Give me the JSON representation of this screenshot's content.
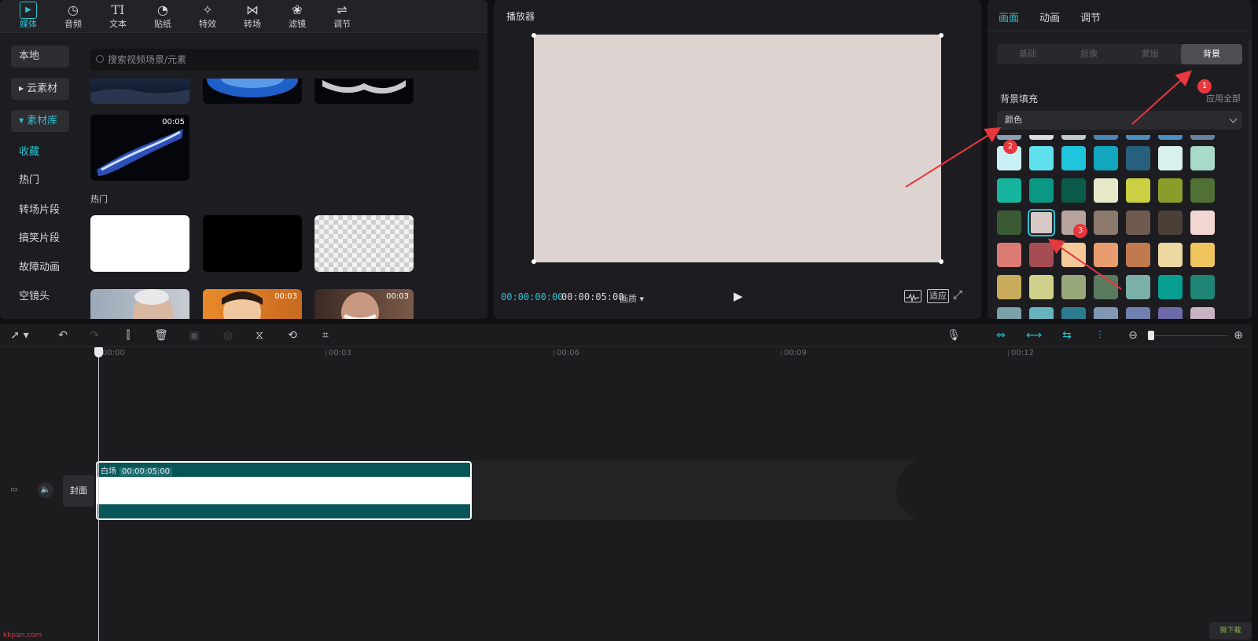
{
  "media": {
    "tools": [
      {
        "label": "媒体",
        "icon": "media-icon",
        "glyph": "▶",
        "active": true
      },
      {
        "label": "音频",
        "icon": "audio-icon",
        "glyph": "◷"
      },
      {
        "label": "文本",
        "icon": "text-icon",
        "glyph": "TI"
      },
      {
        "label": "贴纸",
        "icon": "sticker-icon",
        "glyph": "◔"
      },
      {
        "label": "特效",
        "icon": "effects-icon",
        "glyph": "✧"
      },
      {
        "label": "转场",
        "icon": "transition-icon",
        "glyph": "⋈"
      },
      {
        "label": "滤镜",
        "icon": "filter-icon",
        "glyph": "❀"
      },
      {
        "label": "调节",
        "icon": "adjust-icon",
        "glyph": "⇌"
      }
    ],
    "sidebar": {
      "local": "本地",
      "cloud": "云素材",
      "library": "素材库",
      "items": [
        "收藏",
        "热门",
        "转场片段",
        "搞笑片段",
        "故障动画",
        "空镜头"
      ]
    },
    "search_placeholder": "搜索视频场景/元素",
    "section_hot": "热门",
    "durations": {
      "firework": "00:05",
      "person1": "00:03",
      "person2": "00:03"
    }
  },
  "player": {
    "title": "播放器",
    "current_time": "00:00:00:00",
    "total_time": "00:00:05:00",
    "quality": "画质",
    "fit": "适应"
  },
  "props": {
    "tabs": [
      "画面",
      "动画",
      "调节"
    ],
    "subtabs": [
      "基础",
      "抠像",
      "蒙版",
      "背景"
    ],
    "bg_fill": "背景填充",
    "apply_all": "应用全部",
    "fill_type": "颜色",
    "swatch_colors": [
      [
        "#c9f1f5",
        "#5fe0ec",
        "#1ec5dc",
        "#12a7be",
        "#27607e",
        "#d8f1ec",
        "#a7dac9"
      ],
      [
        "#17b49e",
        "#0a9884",
        "#0a5b49",
        "#e6e8c8",
        "#cbcf42",
        "#8c9c2a",
        "#507035"
      ],
      [
        "#395a33",
        "#d7c9c6",
        "#b6a49c",
        "#8c7a6e",
        "#6e5a4e",
        "#4a4038",
        "#f2d6d2"
      ],
      [
        "#dc7b74",
        "#a64d54",
        "#f5c89a",
        "#e89c70",
        "#c07a4e",
        "#ecd8a0",
        "#f0c45c"
      ],
      [
        "#c8ac5c",
        "#cfd08c",
        "#98a87a",
        "#5a7a5e",
        "#7ab0a8",
        "#089e92",
        "#1e8474"
      ],
      [
        "#79a1a8",
        "#66b4be",
        "#2a7c8e",
        "#8098b4",
        "#7080b0",
        "#6c6aa8",
        "#c8b2c4"
      ]
    ],
    "peek_colors": [
      "#8aa0b2",
      "#d8dde0",
      "#c0cad0",
      "#4a86b8",
      "#4a8ec2",
      "#4a90c8",
      "#6a80a4"
    ],
    "selected_row": 2,
    "selected_col": 1
  },
  "annotations": [
    "1",
    "2",
    "3"
  ],
  "timeline": {
    "ruler": [
      "00:00",
      "00:03",
      "00:06",
      "00:09",
      "00:12"
    ],
    "clip_name": "白场",
    "clip_duration": "00:00:05:00",
    "cover": "封面"
  },
  "watermark": {
    "site": "kkpan.com",
    "logo": "微下载"
  }
}
